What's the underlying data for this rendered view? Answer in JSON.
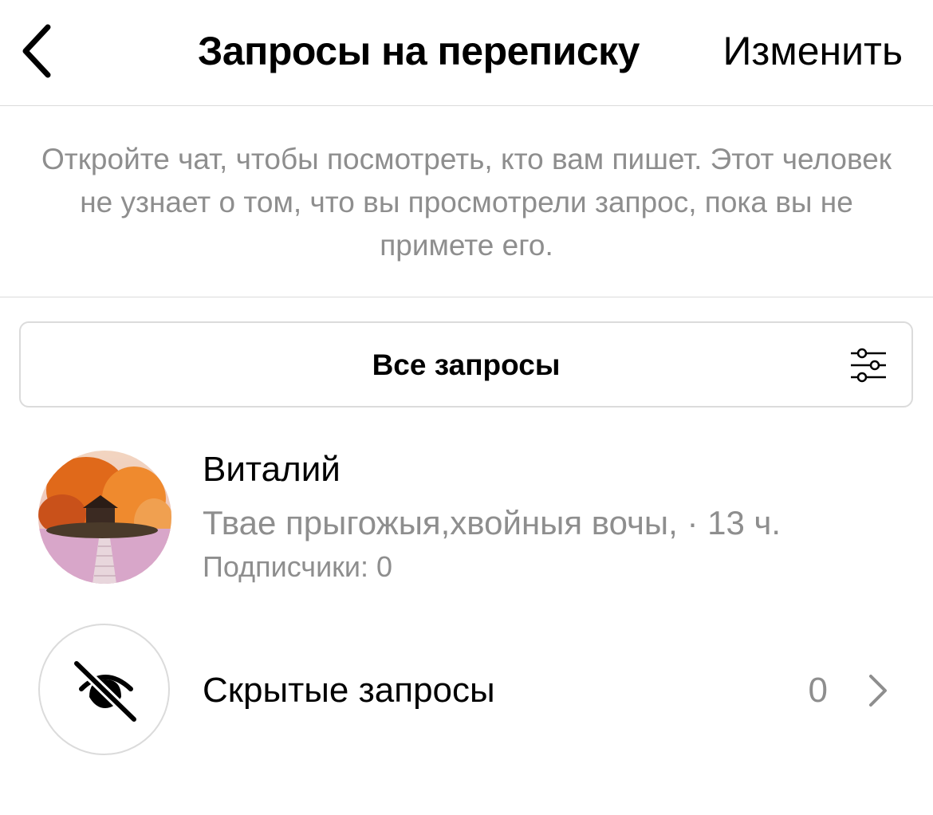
{
  "header": {
    "title": "Запросы на переписку",
    "edit_label": "Изменить"
  },
  "notice": {
    "text": "Откройте чат, чтобы посмотреть, кто вам пишет. Этот человек не узнает о том, что вы просмотрели запрос, пока вы не примете его."
  },
  "filter": {
    "label": "Все запросы"
  },
  "requests": [
    {
      "name": "Виталий",
      "preview": "Твае прыгожыя,хвойныя вочы, · 13 ч.",
      "followers": "Подписчики: 0"
    }
  ],
  "hidden_requests": {
    "label": "Скрытые запросы",
    "count": "0"
  },
  "icons": {
    "back": "chevron-left-icon",
    "filter": "sliders-icon",
    "hidden": "eye-slash-icon",
    "chevron": "chevron-right-icon"
  },
  "colors": {
    "secondary_text": "#8e8e8e",
    "divider": "#dbdbdb"
  }
}
